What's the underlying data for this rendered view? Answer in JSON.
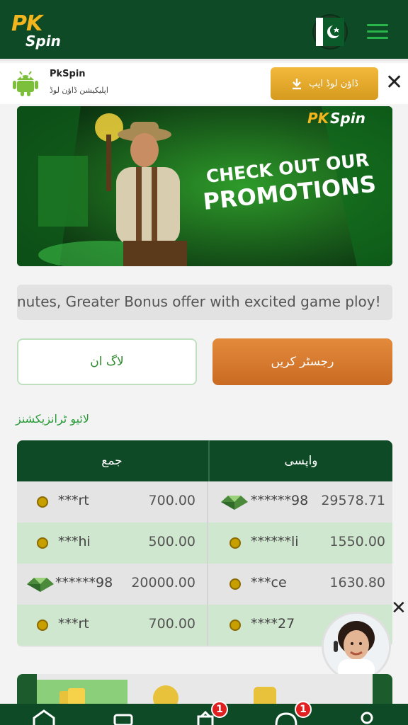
{
  "header": {
    "logo_pk": "PK",
    "logo_spin": "Spin",
    "flag_icon": "pakistan-flag-icon",
    "menu_icon": "hamburger-menu-icon"
  },
  "app_bar": {
    "app_name": "PkSpin",
    "description": "اپلیکیشن ڈاؤن لوڈ",
    "download_label": "ڈاؤن لوڈ ایپ",
    "close": "✕"
  },
  "banner": {
    "brand": "PKSpin",
    "line1": "CHECK OUT OUR",
    "line2": "PROMOTIONS"
  },
  "ticker": {
    "text": "nutes, Greater Bonus offer with excited game ploy!"
  },
  "auth": {
    "login_label": "لاگ ان",
    "register_label": "رجسٹر کریں"
  },
  "live_section": {
    "title": "لائیو ٹرانزیکشنز"
  },
  "transactions": {
    "headers": [
      "جمع",
      "واپسی"
    ],
    "rows": [
      {
        "left_user": "***rt",
        "left_amount": "700.00",
        "right_user": "******98",
        "right_amount": "29578.71"
      },
      {
        "left_user": "***hi",
        "left_amount": "500.00",
        "right_user": "******li",
        "right_amount": "1550.00"
      },
      {
        "left_user": "******98",
        "left_amount": "20000.00",
        "right_user": "***ce",
        "right_amount": "1630.80"
      },
      {
        "left_user": "***rt",
        "left_amount": "700.00",
        "right_user": "****27",
        "right_amount": ""
      }
    ]
  },
  "bottom_nav": {
    "badges": [
      "1",
      "1"
    ]
  },
  "colors": {
    "primary_green": "#0e4a26",
    "accent_orange": "#c96b22",
    "accent_gold": "#f2b51d",
    "badge_red": "#e02020"
  }
}
